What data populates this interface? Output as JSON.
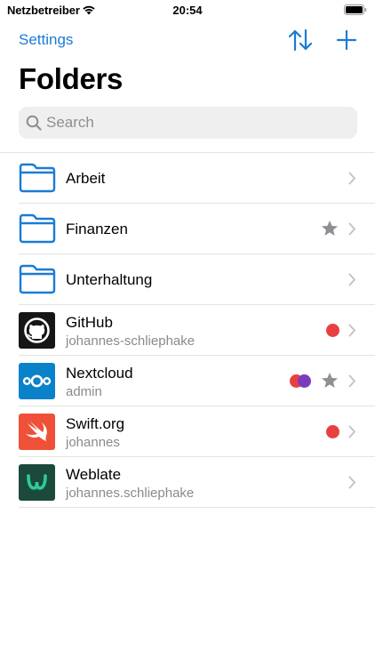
{
  "status_bar": {
    "carrier": "Netzbetreiber",
    "time": "20:54"
  },
  "nav": {
    "settings_label": "Settings"
  },
  "page_title": "Folders",
  "search": {
    "placeholder": "Search"
  },
  "folders": [
    {
      "name": "Arbeit",
      "favorite": false
    },
    {
      "name": "Finanzen",
      "favorite": true
    },
    {
      "name": "Unterhaltung",
      "favorite": false
    }
  ],
  "entries": [
    {
      "name": "GitHub",
      "username": "johannes-schliephake",
      "icon": "github-icon",
      "tags": [
        "red"
      ],
      "favorite": false
    },
    {
      "name": "Nextcloud",
      "username": "admin",
      "icon": "nextcloud-icon",
      "tags": [
        "red",
        "purple"
      ],
      "favorite": true
    },
    {
      "name": "Swift.org",
      "username": "johannes",
      "icon": "swift-icon",
      "tags": [
        "red"
      ],
      "favorite": false
    },
    {
      "name": "Weblate",
      "username": "johannes.schliephake",
      "icon": "weblate-icon",
      "tags": [],
      "favorite": false
    }
  ],
  "colors": {
    "accent": "#1a7bd6",
    "tag_red": "#e84040",
    "tag_purple": "#7a3bbd",
    "star_gray": "#8e8e93",
    "github_bg": "#161616",
    "nextcloud_bg": "#0a82c9",
    "swift_bg": "#ef5138",
    "weblate_bg": "#1b4a3d"
  }
}
